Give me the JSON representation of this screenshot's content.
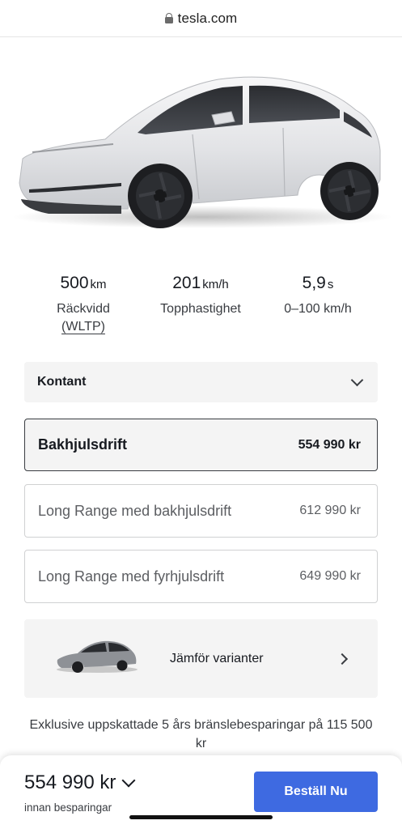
{
  "browser": {
    "domain": "tesla.com"
  },
  "specs": [
    {
      "value": "500",
      "unit": "km",
      "label": "Räckvidd",
      "label2": "(WLTP)"
    },
    {
      "value": "201",
      "unit": "km/h",
      "label": "Topphastighet"
    },
    {
      "value": "5,9",
      "unit": "s",
      "label": "0–100 km/h"
    }
  ],
  "payment": {
    "selected": "Kontant"
  },
  "variants": [
    {
      "name": "Bakhjulsdrift",
      "price": "554 990 kr",
      "selected": true
    },
    {
      "name": "Long Range med bakhjulsdrift",
      "price": "612 990 kr",
      "selected": false
    },
    {
      "name": "Long Range med fyrhjulsdrift",
      "price": "649 990 kr",
      "selected": false
    }
  ],
  "compare": {
    "label": "Jämför varianter"
  },
  "savings": {
    "text": "Exklusive uppskattade 5 års bränslebesparingar på 115 500 kr"
  },
  "footer": {
    "price": "554 990 kr",
    "subtext": "innan besparingar",
    "cta": "Beställ Nu"
  },
  "colors": {
    "accent": "#3e6ae1",
    "text": "#171a20",
    "panel": "#f4f4f4"
  }
}
